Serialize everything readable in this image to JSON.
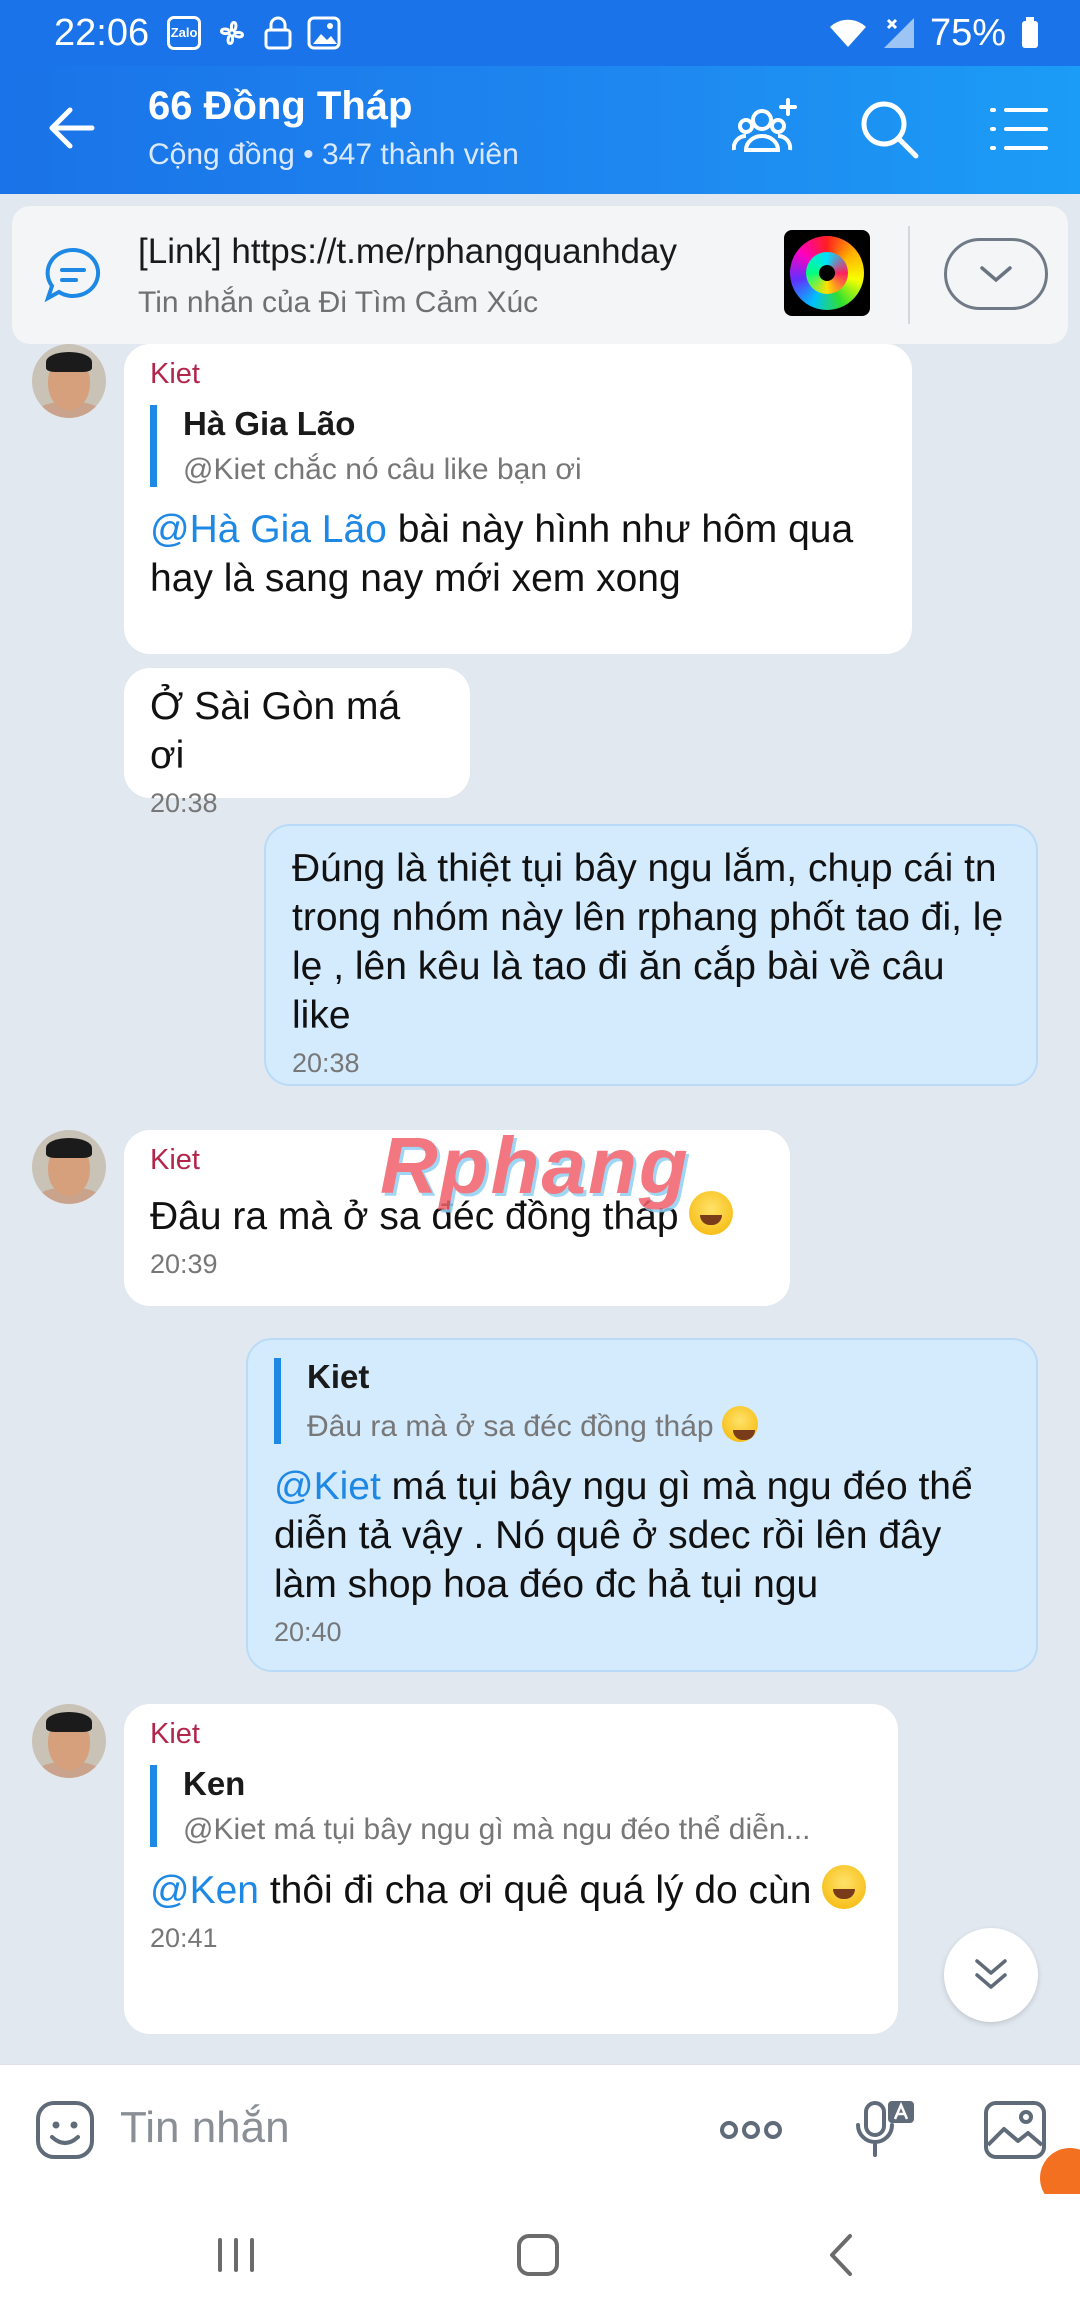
{
  "status_bar": {
    "time": "22:06",
    "zalo_label": "Zalo",
    "battery": "75%"
  },
  "header": {
    "title": "66 Đồng Tháp",
    "subtitle": "Cộng đồng • 347 thành viên"
  },
  "pinned": {
    "title": "[Link] https://t.me/rphangquanhday",
    "subtitle": "Tin nhắn của Đi Tìm Cảm Xúc"
  },
  "watermark": "Rphang",
  "messages": [
    {
      "sender": "Kiet",
      "quote_name": "Hà Gia Lão",
      "quote_text": "@Kiet chắc nó câu like bạn ơi",
      "mention": "@Hà Gia Lão",
      "text": " bài này hình như hôm qua hay là sang nay mới xem xong"
    },
    {
      "text": "Ở Sài Gòn má ơi",
      "time": "20:38"
    },
    {
      "text": "Đúng là thiệt tụi bây ngu lắm, chụp cái tn trong nhóm này lên rphang phốt tao đi, lẹ lẹ , lên kêu là tao đi ăn cắp bài về câu like",
      "time": "20:38"
    },
    {
      "sender": "Kiet",
      "text": "Đâu ra mà ở sa đéc đồng tháp ",
      "time": "20:39"
    },
    {
      "quote_name": "Kiet",
      "quote_text": "Đâu ra mà ở sa đéc đồng tháp ",
      "mention": "@Kiet",
      "text": " má tụi bây ngu gì mà ngu đéo thể diễn tả vậy . Nó quê ở sdec rồi lên đây làm shop hoa đéo đc hả tụi ngu",
      "time": "20:40"
    },
    {
      "sender": "Kiet",
      "quote_name": "Ken",
      "quote_text": "@Kiet má tụi bây ngu gì mà ngu đéo thể diễn...",
      "mention": "@Ken",
      "text": " thôi đi cha ơi quê quá lý do cùn ",
      "time": "20:41"
    }
  ],
  "input": {
    "placeholder": "Tin nhắn"
  },
  "icons": {
    "back": "arrow-left-icon",
    "add_member": "add-member-icon",
    "search": "search-icon",
    "menu": "list-menu-icon",
    "pinned": "chat-bubble-icon",
    "expand": "chevron-down-icon",
    "scroll_down": "double-chevron-down-icon",
    "sticker": "sticker-icon",
    "more": "more-icon",
    "voice": "microphone-icon",
    "image": "image-icon"
  },
  "colors": {
    "header_blue": "#1a73e8",
    "outgoing_bubble": "#d4eafd",
    "sender_name": "#b3264b",
    "mention": "#1e88e5"
  }
}
